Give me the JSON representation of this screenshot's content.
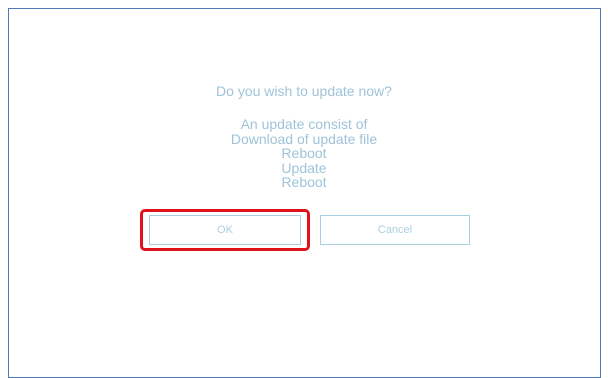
{
  "dialog": {
    "question": "Do you wish to update now?",
    "info_lines": [
      "An update consist of",
      "Download of update file",
      "Reboot",
      "Update",
      "Reboot"
    ],
    "ok_label": "OK",
    "cancel_label": "Cancel"
  },
  "colors": {
    "text": "#9fc3d8",
    "button_border": "#a9cfe0",
    "frame_border": "#4f7bbd",
    "highlight": "#e0121b"
  }
}
